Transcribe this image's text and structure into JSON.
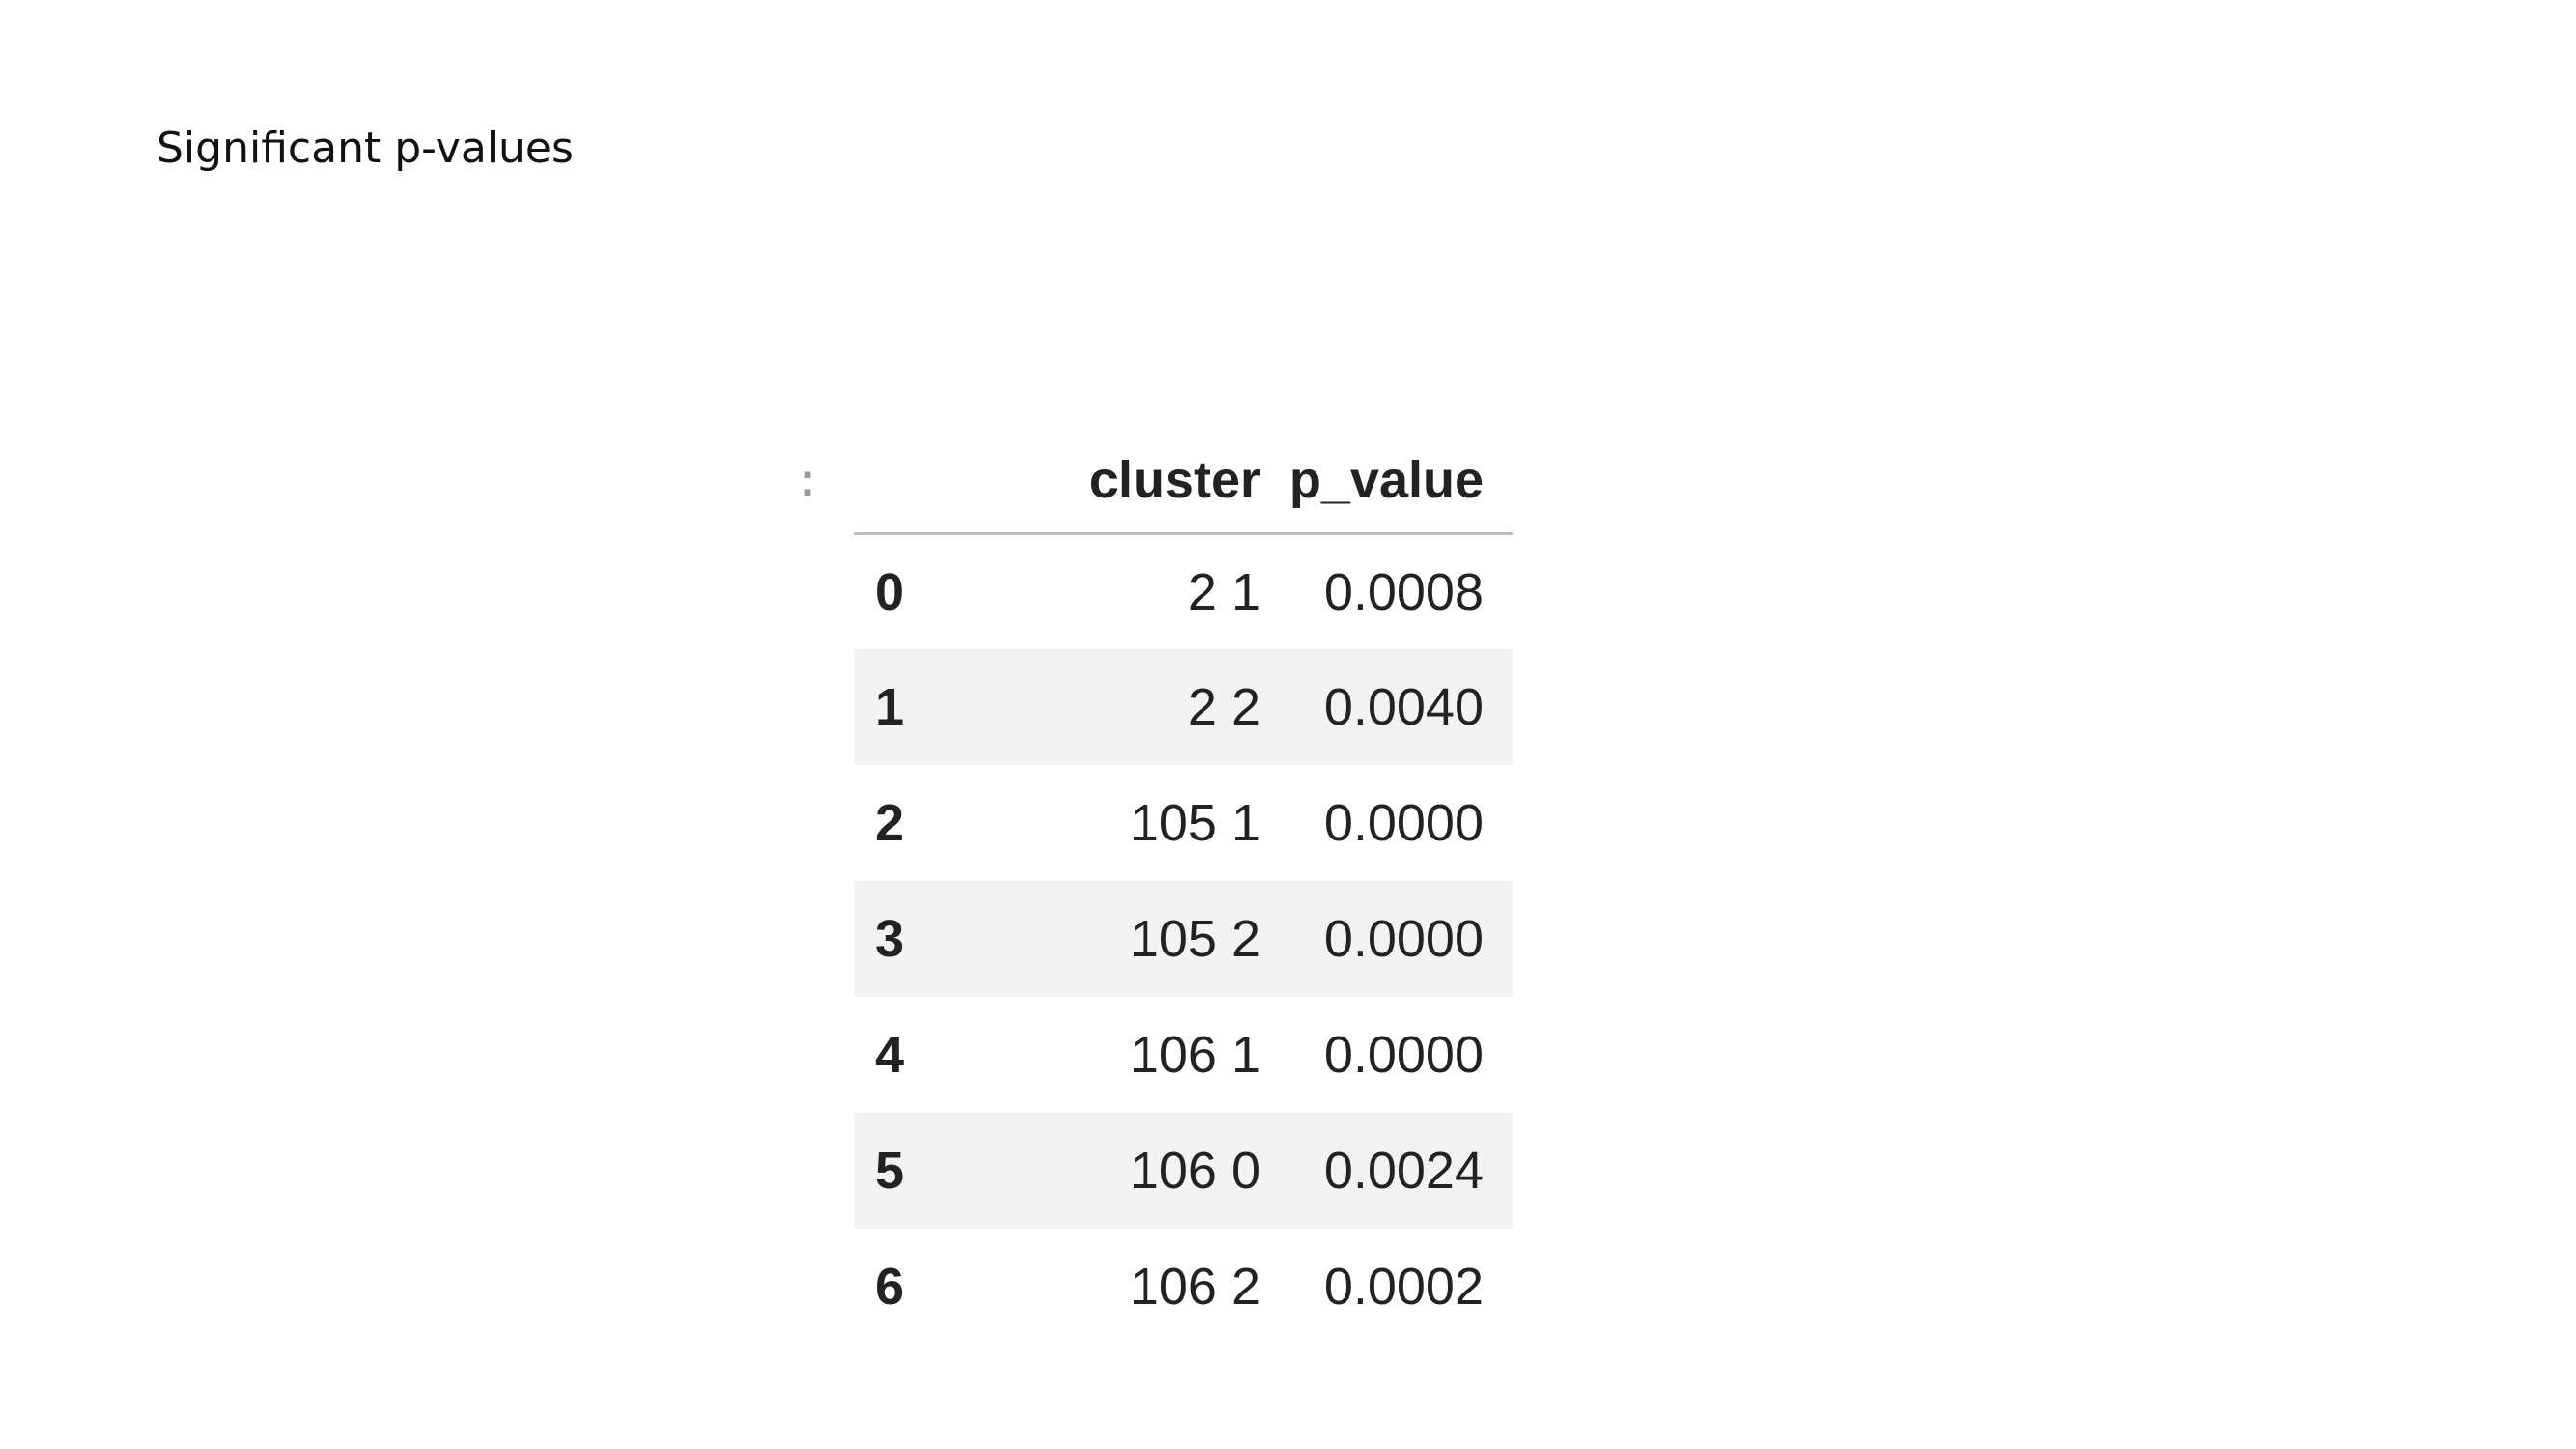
{
  "slide": {
    "title": "Significant p-values"
  },
  "notebook": {
    "prompt_marker": ":"
  },
  "table": {
    "columns": [
      "",
      "cluster",
      "p_value"
    ],
    "rows": [
      {
        "index": "0",
        "cluster": "2 1",
        "p_value": "0.0008"
      },
      {
        "index": "1",
        "cluster": "2 2",
        "p_value": "0.0040"
      },
      {
        "index": "2",
        "cluster": "105 1",
        "p_value": "0.0000"
      },
      {
        "index": "3",
        "cluster": "105 2",
        "p_value": "0.0000"
      },
      {
        "index": "4",
        "cluster": "106 1",
        "p_value": "0.0000"
      },
      {
        "index": "5",
        "cluster": "106 0",
        "p_value": "0.0024"
      },
      {
        "index": "6",
        "cluster": "106 2",
        "p_value": "0.0002"
      }
    ]
  },
  "colors": {
    "striped_row_background": "#f3f3f3",
    "header_rule": "#bdbdbd",
    "text": "#222222"
  }
}
